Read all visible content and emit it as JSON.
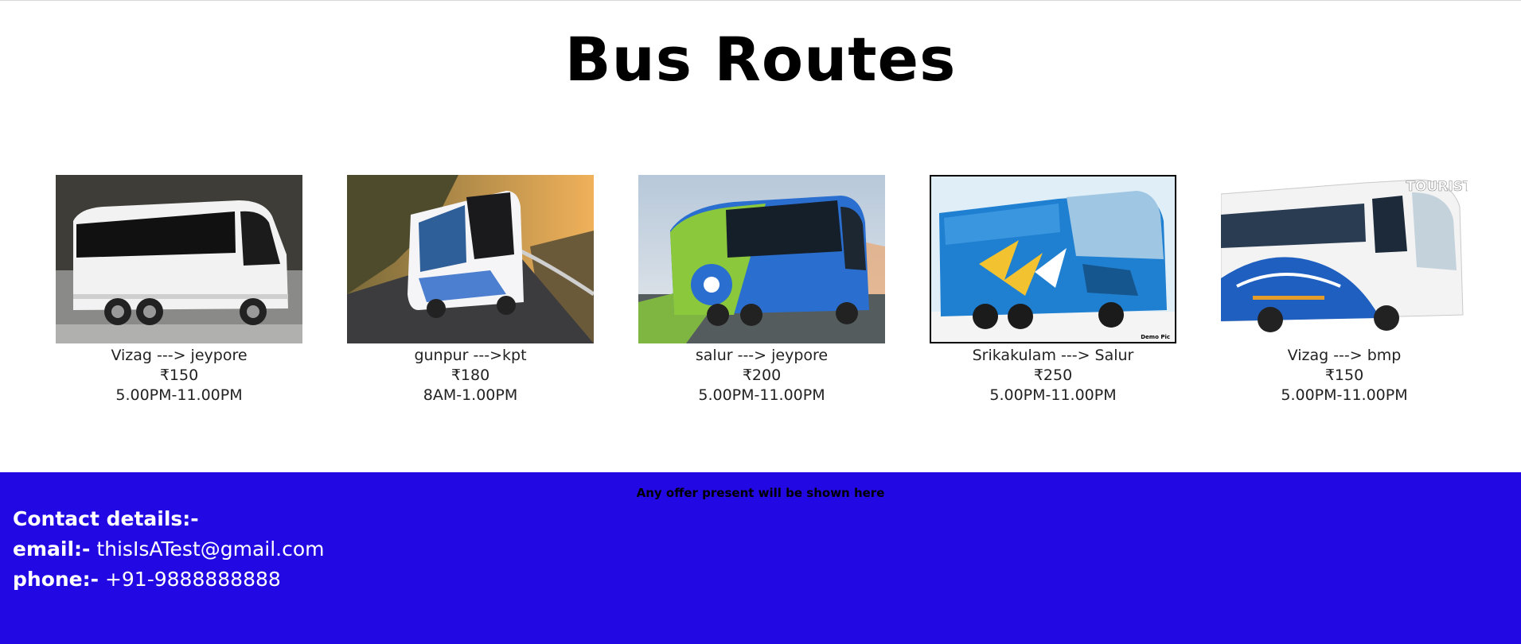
{
  "page": {
    "title": "Bus Routes"
  },
  "routes": [
    {
      "route": "Vizag ---> jeypore",
      "price": "₹150",
      "timing": "5.00PM-11.00PM",
      "image": "white-coach-bus"
    },
    {
      "route": "gunpur --->kpt",
      "price": "₹180",
      "timing": "8AM-1.00PM",
      "image": "white-blue-coach-mountain-road"
    },
    {
      "route": "salur ---> jeypore",
      "price": "₹200",
      "timing": "5.00PM-11.00PM",
      "image": "green-blue-coach-bus"
    },
    {
      "route": "Srikakulam ---> Salur",
      "price": "₹250",
      "timing": "5.00PM-11.00PM",
      "image": "blue-bus-demo-pic",
      "watermark": "Demo Pic"
    },
    {
      "route": "Vizag ---> bmp",
      "price": "₹150",
      "timing": "5.00PM-11.00PM",
      "image": "tourist-bus",
      "bus_text": "TOURIST"
    }
  ],
  "footer": {
    "offer_text": "Any offer present will be shown here",
    "contact_heading": "Contact details:-",
    "email_label": "email:-",
    "email_value": "thisIsATest@gmail.com",
    "phone_label": "phone:-",
    "phone_value": "+91-9888888888"
  },
  "colors": {
    "footer_bg": "#2208e2",
    "footer_text": "#ffffff",
    "offer_text": "#000000"
  }
}
